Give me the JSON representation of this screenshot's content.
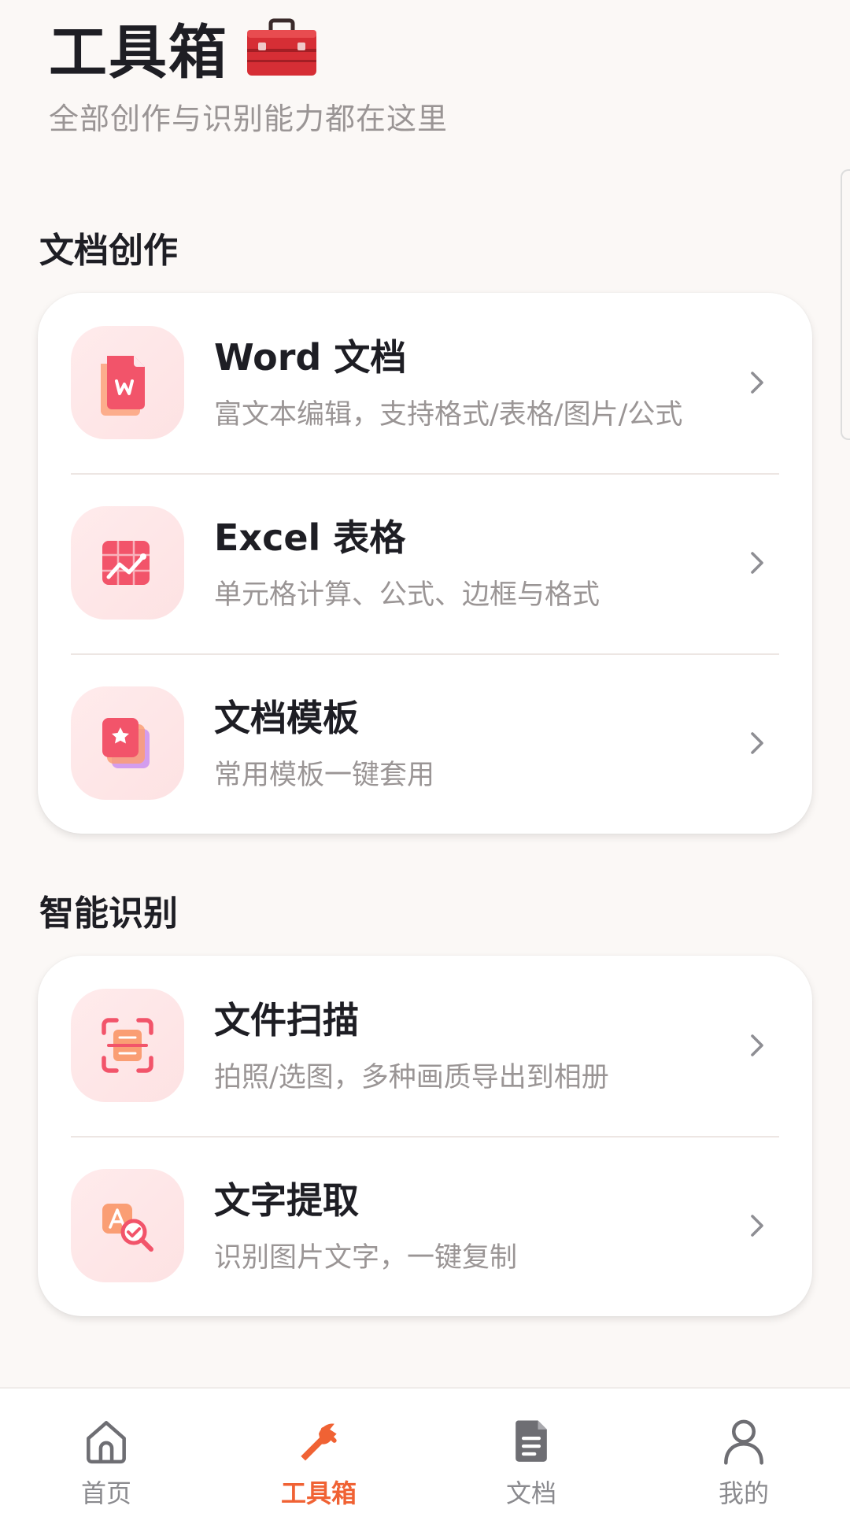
{
  "header": {
    "title": "工具箱",
    "title_emoji": "toolbox-emoji-icon",
    "subtitle": "全部创作与识别能力都在这里"
  },
  "sections": [
    {
      "title": "文档创作",
      "items": [
        {
          "title": "Word 文档",
          "desc": "富文本编辑，支持格式/表格/图片/公式",
          "icon": "word-doc-icon"
        },
        {
          "title": "Excel 表格",
          "desc": "单元格计算、公式、边框与格式",
          "icon": "excel-sheet-icon"
        },
        {
          "title": "文档模板",
          "desc": "常用模板一键套用",
          "icon": "template-icon"
        }
      ]
    },
    {
      "title": "智能识别",
      "items": [
        {
          "title": "文件扫描",
          "desc": "拍照/选图，多种画质导出到相册",
          "icon": "scan-icon"
        },
        {
          "title": "文字提取",
          "desc": "识别图片文字，一键复制",
          "icon": "text-extract-icon"
        }
      ]
    }
  ],
  "tabbar": {
    "active": 1,
    "items": [
      {
        "label": "首页",
        "icon": "home-icon"
      },
      {
        "label": "工具箱",
        "icon": "toolbox-icon"
      },
      {
        "label": "文档",
        "icon": "document-icon"
      },
      {
        "label": "我的",
        "icon": "profile-icon"
      }
    ]
  },
  "colors": {
    "accent": "#F06234",
    "background": "#FBF8F6",
    "card": "#FFFFFF",
    "icon_bg": "#FDE4E5",
    "title": "#1E1E24",
    "muted": "#9A9595",
    "tab_inactive": "#8A8A8E"
  }
}
